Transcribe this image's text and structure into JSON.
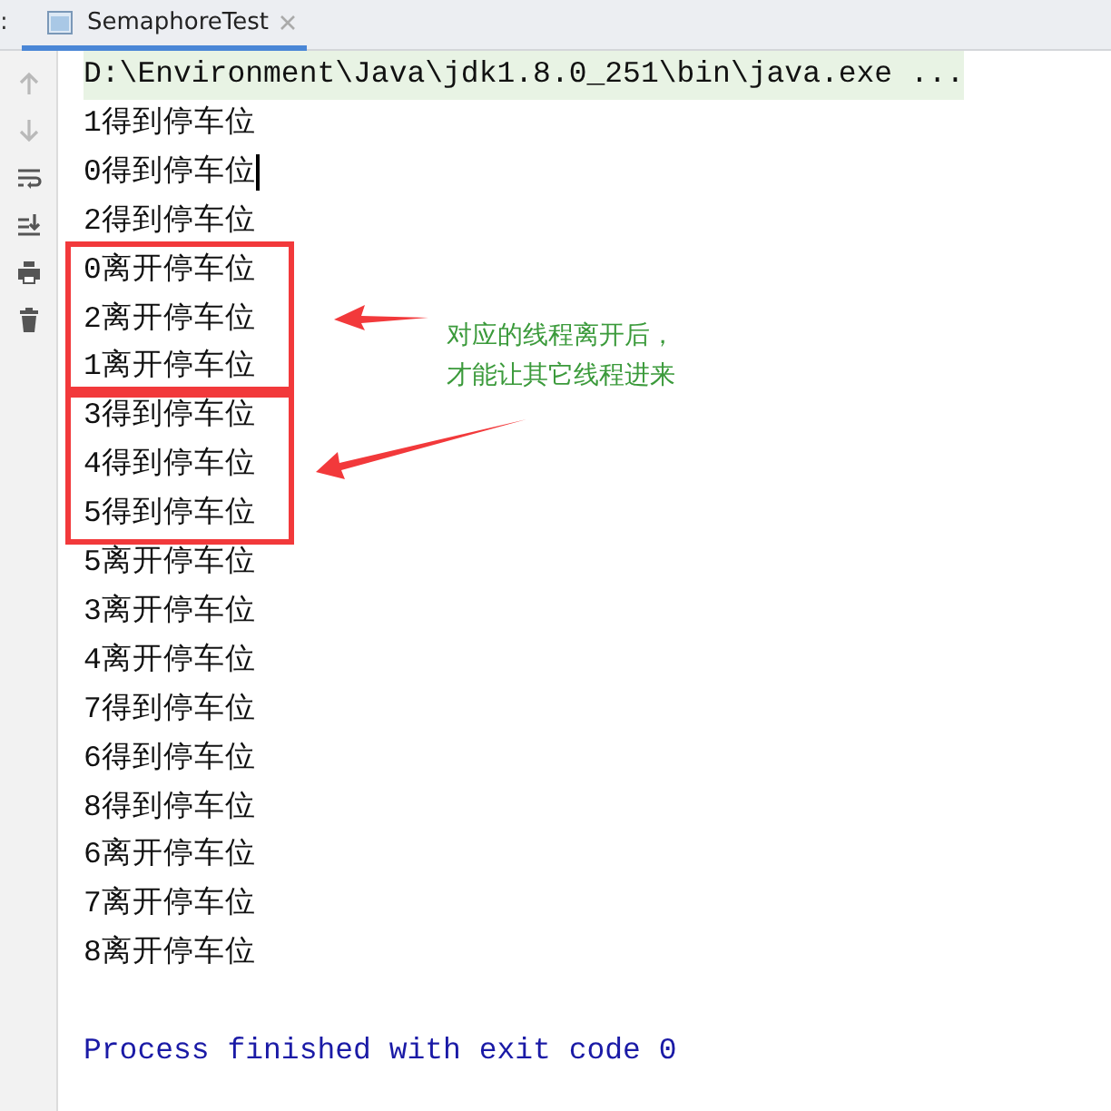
{
  "edge_label": ":",
  "tab": {
    "title": "SemaphoreTest",
    "selected": true
  },
  "toolbar": [
    {
      "kind": "up",
      "disabled": true
    },
    {
      "kind": "down",
      "disabled": true
    },
    {
      "kind": "wrap",
      "disabled": false
    },
    {
      "kind": "scroll",
      "disabled": false
    },
    {
      "kind": "print",
      "disabled": false
    },
    {
      "kind": "trash",
      "disabled": false
    }
  ],
  "console": {
    "groups": [
      {
        "boxed": false,
        "lines": [
          {
            "kind": "command",
            "text": "D:\\Environment\\Java\\jdk1.8.0_251\\bin\\java.exe ...",
            "cursor": false
          },
          {
            "kind": "output",
            "text": "1得到停车位",
            "cursor": false
          },
          {
            "kind": "output",
            "text": "0得到停车位",
            "cursor": true
          },
          {
            "kind": "output",
            "text": "2得到停车位",
            "cursor": false
          }
        ]
      },
      {
        "boxed": true,
        "lines": [
          {
            "kind": "output",
            "text": "0离开停车位",
            "cursor": false
          },
          {
            "kind": "output",
            "text": "2离开停车位",
            "cursor": false
          },
          {
            "kind": "output",
            "text": "1离开停车位",
            "cursor": false
          }
        ]
      },
      {
        "boxed": true,
        "lines": [
          {
            "kind": "output",
            "text": "3得到停车位",
            "cursor": false
          },
          {
            "kind": "output",
            "text": "4得到停车位",
            "cursor": false
          },
          {
            "kind": "output",
            "text": "5得到停车位",
            "cursor": false
          }
        ]
      },
      {
        "boxed": false,
        "lines": [
          {
            "kind": "output",
            "text": "5离开停车位",
            "cursor": false
          },
          {
            "kind": "output",
            "text": "3离开停车位",
            "cursor": false
          },
          {
            "kind": "output",
            "text": "4离开停车位",
            "cursor": false
          },
          {
            "kind": "output",
            "text": "7得到停车位",
            "cursor": false
          },
          {
            "kind": "output",
            "text": "6得到停车位",
            "cursor": false
          },
          {
            "kind": "output",
            "text": "8得到停车位",
            "cursor": false
          },
          {
            "kind": "output",
            "text": "6离开停车位",
            "cursor": false
          },
          {
            "kind": "output",
            "text": "7离开停车位",
            "cursor": false
          },
          {
            "kind": "output",
            "text": "8离开停车位",
            "cursor": false
          },
          {
            "kind": "blank"
          },
          {
            "kind": "exit",
            "text": "Process finished with exit code 0",
            "cursor": false
          }
        ]
      }
    ]
  },
  "annotation": {
    "note": [
      "对应的线程离开后，",
      "才能让其它线程进来"
    ]
  }
}
